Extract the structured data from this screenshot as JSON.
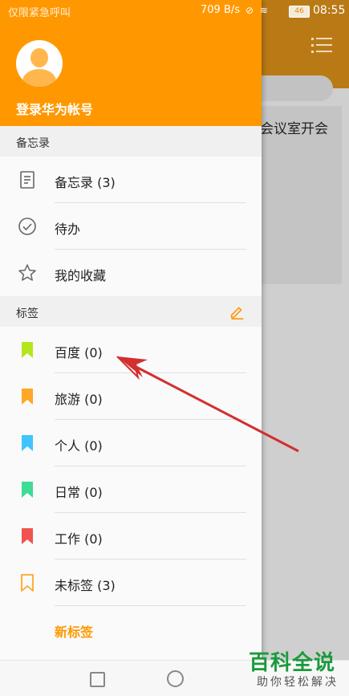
{
  "status_bar": {
    "carrier": "仅限紧急呼叫",
    "net_speed": "709 B/s",
    "battery": "46",
    "time": "08:55"
  },
  "background_app": {
    "card_text": "会议室开会",
    "menu_icon": "list-icon"
  },
  "drawer": {
    "account": {
      "login_label": "登录华为帐号",
      "avatar_icon": "user-avatar-icon"
    },
    "notes_section": {
      "title": "备忘录",
      "items": [
        {
          "label": "备忘录 (3)",
          "icon": "note-icon"
        },
        {
          "label": "待办",
          "icon": "check-circle-icon"
        },
        {
          "label": "我的收藏",
          "icon": "star-icon"
        }
      ]
    },
    "tags_section": {
      "title": "标签",
      "edit_icon": "pencil-icon",
      "items": [
        {
          "label": "百度 (0)",
          "color": "#b5e61d"
        },
        {
          "label": "旅游 (0)",
          "color": "#ffa726"
        },
        {
          "label": "个人 (0)",
          "color": "#40c4ff"
        },
        {
          "label": "日常 (0)",
          "color": "#3ddc97"
        },
        {
          "label": "工作 (0)",
          "color": "#ef5350"
        },
        {
          "label": "未标签 (3)",
          "color": "#ffa726"
        }
      ],
      "new_tag_label": "新标签"
    }
  },
  "nav_bar": {
    "recent_icon": "square-icon",
    "home_icon": "circle-icon"
  },
  "watermark": {
    "title": "百科全说",
    "subtitle": "助你轻松解决"
  },
  "colors": {
    "accent": "#ff9800",
    "annotation_arrow": "#d32f2f"
  }
}
